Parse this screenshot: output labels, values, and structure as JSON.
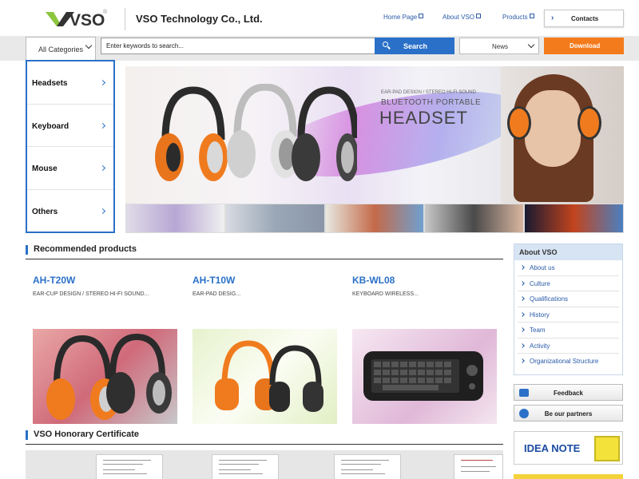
{
  "header": {
    "logo_text": "VSO",
    "company": "VSO Technology Co., Ltd.",
    "links": [
      {
        "label": "Home Page"
      },
      {
        "label": "About VSO"
      },
      {
        "label": "Products"
      }
    ],
    "contacts_label": "Contacts"
  },
  "searchbar": {
    "categories_label": "All Categories",
    "placeholder": "Enter keywords to search...",
    "search_label": "Search",
    "news_label": "News",
    "download_label": "Download"
  },
  "categories": [
    {
      "label": "Headsets"
    },
    {
      "label": "Keyboard"
    },
    {
      "label": "Mouse"
    },
    {
      "label": "Others"
    }
  ],
  "banner": {
    "tagline": "EAR-PAD DESIGN / STEREO HI-FI SOUND",
    "line1": "BLUETOOTH PORTABLE",
    "line2": "HEADSET"
  },
  "recommended": {
    "title": "Recommended products",
    "products": [
      {
        "name": "AH-T20W",
        "desc": "EAR-CUP DESIGN / STEREO HI-FI SOUND..."
      },
      {
        "name": "AH-T10W",
        "desc": "EAR-PAD DESIG..."
      },
      {
        "name": "KB-WL08",
        "desc": "KEYBOARD WIRELESS..."
      }
    ]
  },
  "certificates": {
    "title": "VSO Honorary Certificate"
  },
  "about": {
    "title": "About VSO",
    "items": [
      {
        "label": "About us"
      },
      {
        "label": "Culture"
      },
      {
        "label": "Qualifications"
      },
      {
        "label": "History"
      },
      {
        "label": "Team"
      },
      {
        "label": "Activity"
      },
      {
        "label": "Organizational Structure"
      }
    ],
    "feedback_label": "Feedback",
    "partners_label": "Be our partners",
    "ideanote_label": "IDEA NOTE"
  },
  "colors": {
    "accent": "#2a70c8",
    "download": "#f47b1c",
    "headphone_orange": "#f07b1e"
  }
}
